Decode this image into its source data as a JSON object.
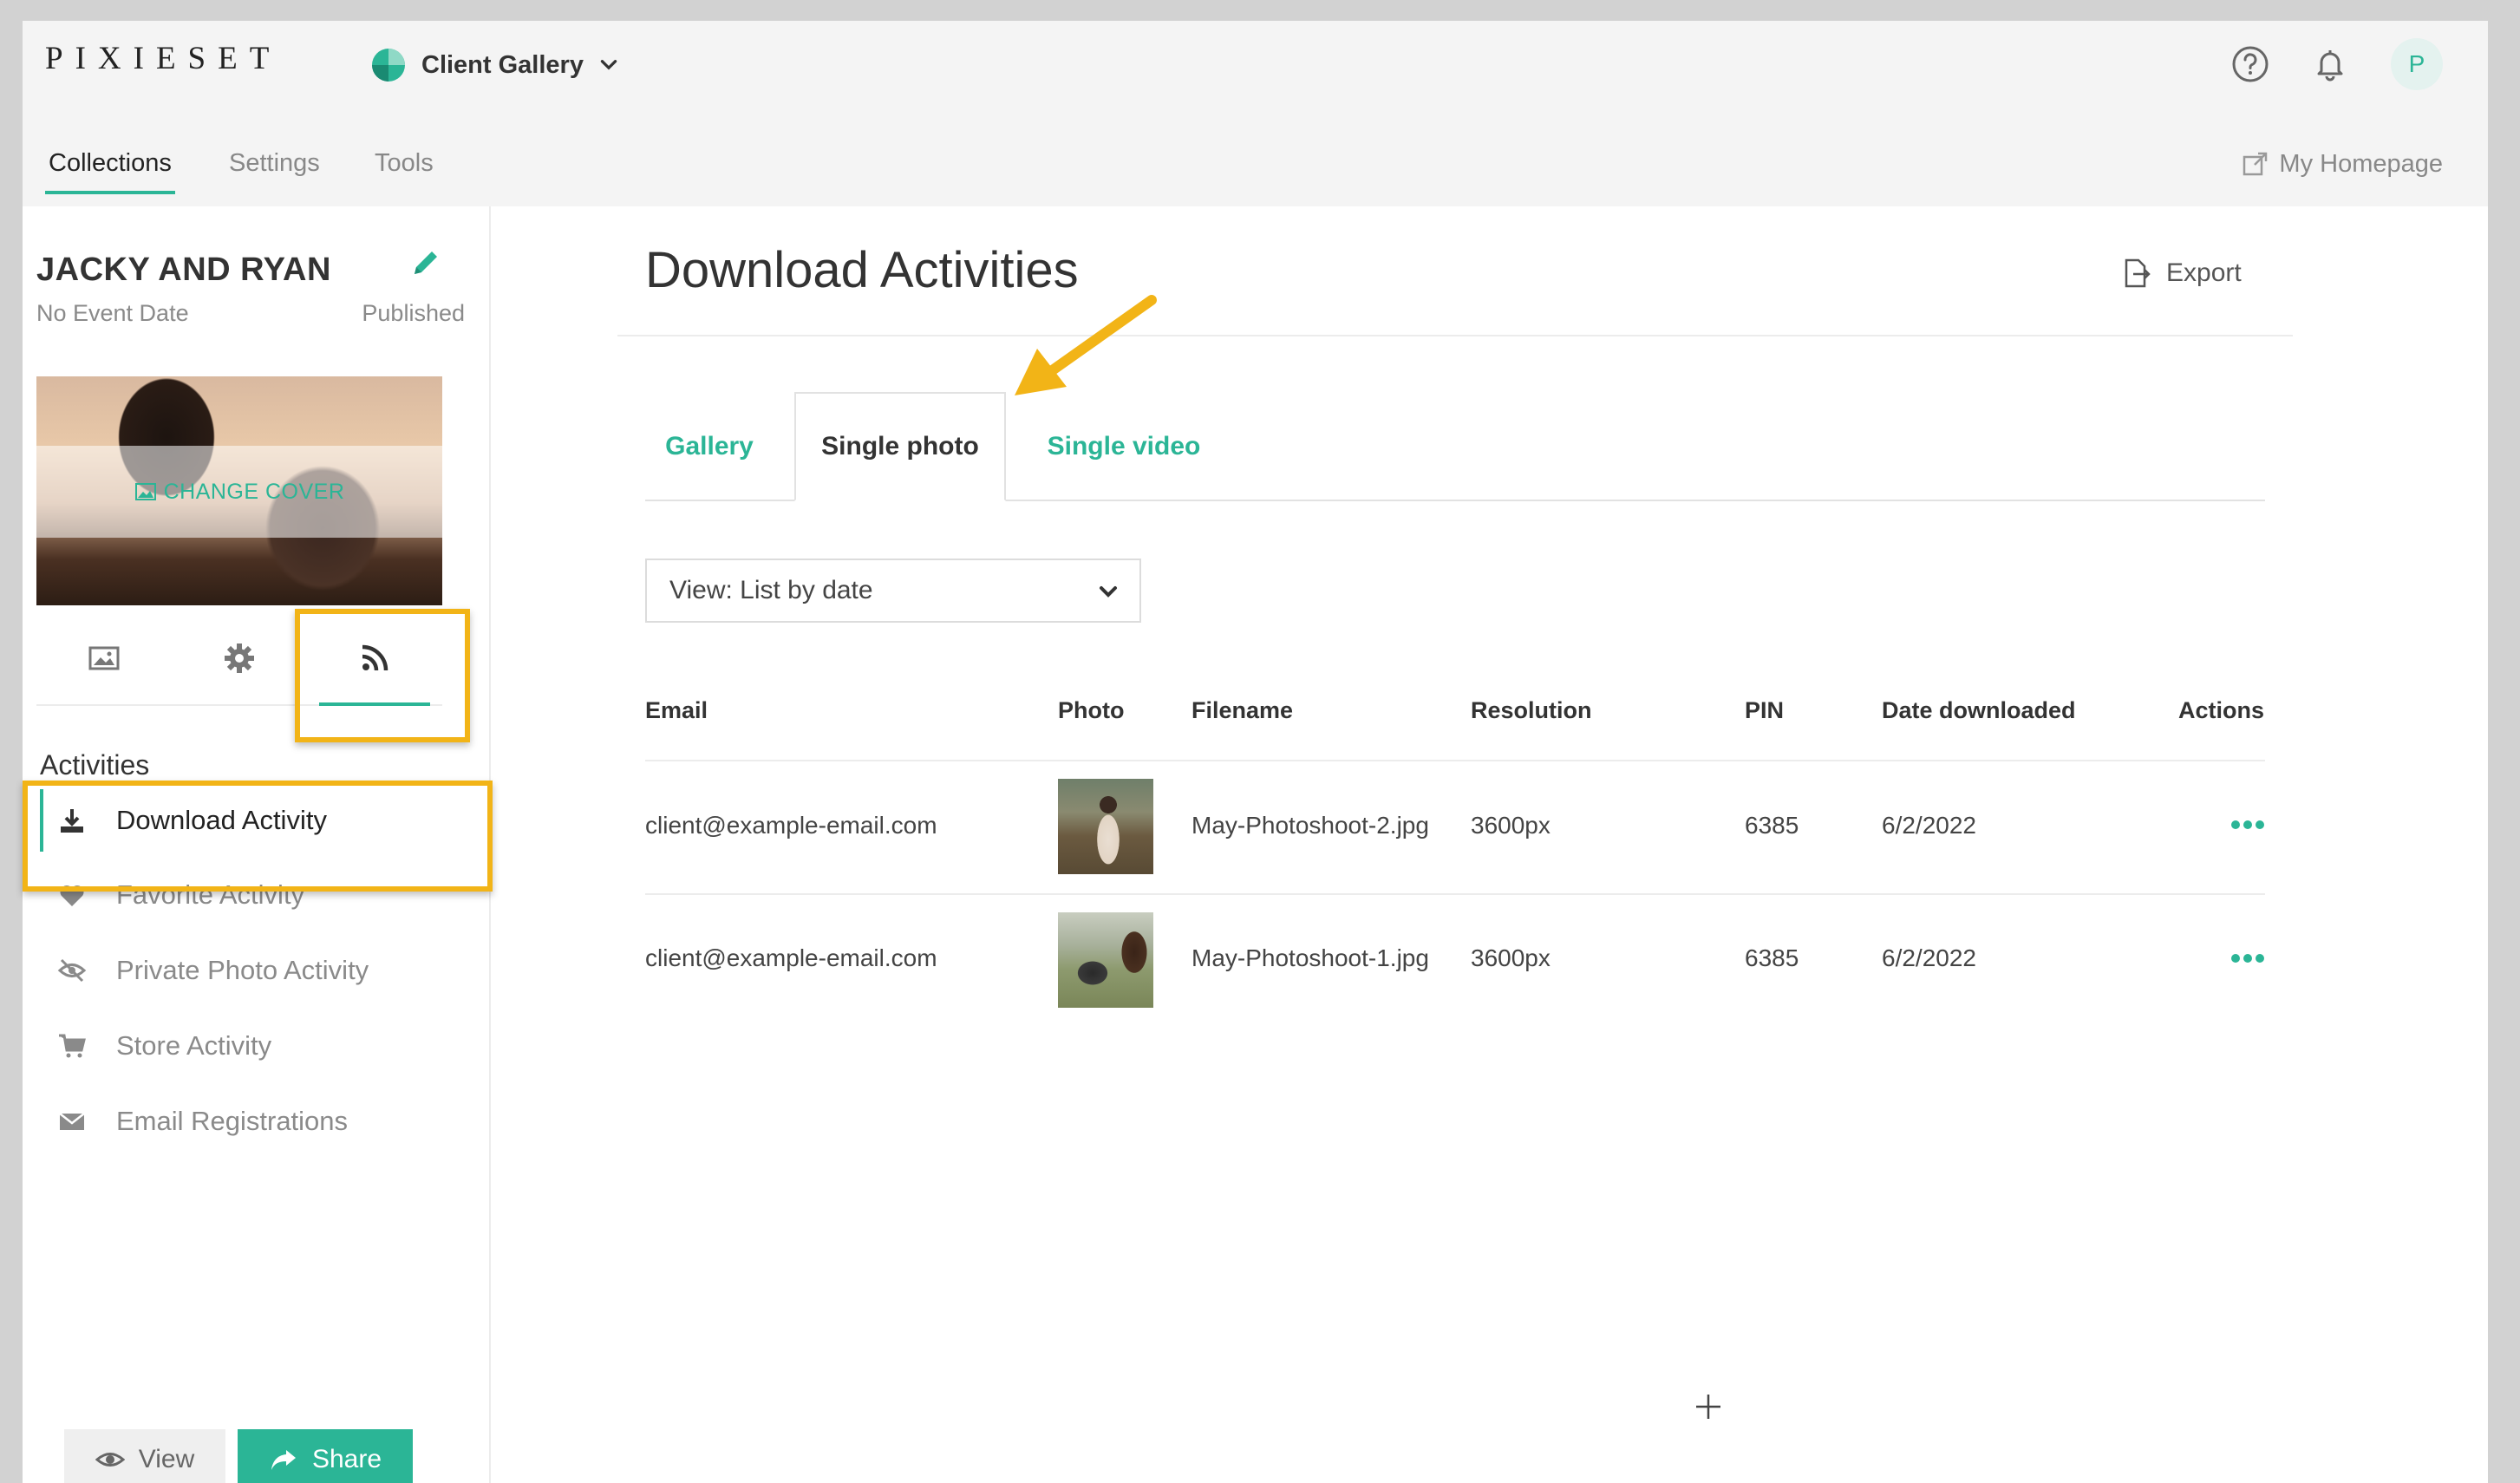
{
  "app": {
    "logo": "PIXIESET",
    "gallery_switcher": "Client Gallery",
    "avatar_initial": "P",
    "accent_color": "#2bb596",
    "highlight_color": "#f2b417"
  },
  "nav": {
    "tabs": [
      "Collections",
      "Settings",
      "Tools"
    ],
    "homepage_link": "My Homepage"
  },
  "collection": {
    "title": "JACKY AND RYAN",
    "date": "No Event Date",
    "status": "Published",
    "cover_label": "CHANGE COVER"
  },
  "sidebar": {
    "activities_heading": "Activities",
    "items": [
      {
        "label": "Download Activity",
        "icon": "download-icon"
      },
      {
        "label": "Favorite Activity",
        "icon": "heart-icon"
      },
      {
        "label": "Private Photo Activity",
        "icon": "eye-slash-icon"
      },
      {
        "label": "Store Activity",
        "icon": "cart-icon"
      },
      {
        "label": "Email Registrations",
        "icon": "envelope-icon"
      }
    ],
    "view_button": "View",
    "share_button": "Share"
  },
  "main": {
    "title": "Download Activities",
    "export_label": "Export",
    "tabs": [
      "Gallery",
      "Single photo",
      "Single video"
    ],
    "view_select": "View: List by date",
    "columns": [
      "Email",
      "Photo",
      "Filename",
      "Resolution",
      "PIN",
      "Date downloaded",
      "Actions"
    ],
    "rows": [
      {
        "email": "client@example-email.com",
        "filename": "May-Photoshoot-2.jpg",
        "resolution": "3600px",
        "pin": "6385",
        "date": "6/2/2022"
      },
      {
        "email": "client@example-email.com",
        "filename": "May-Photoshoot-1.jpg",
        "resolution": "3600px",
        "pin": "6385",
        "date": "6/2/2022"
      }
    ]
  }
}
